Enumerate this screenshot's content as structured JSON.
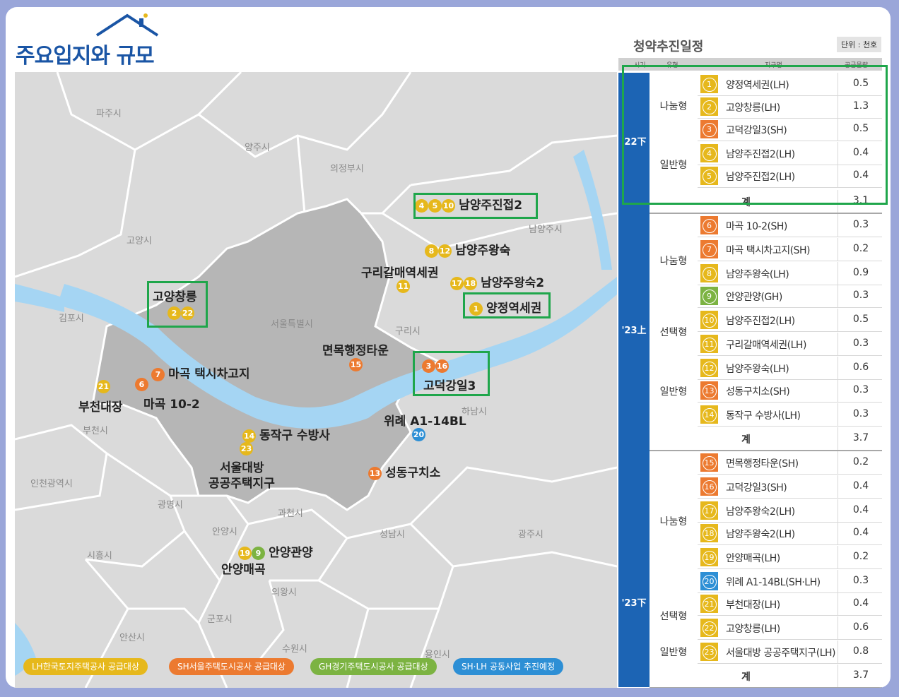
{
  "title": "주요입지와 규모",
  "map": {
    "places": [
      "파주시",
      "양주시",
      "의정부시",
      "남양주시",
      "고양시",
      "김포시",
      "서울특별시",
      "구리시",
      "하남시",
      "부천시",
      "인천광역시",
      "광명시",
      "과천시",
      "안양시",
      "성남시",
      "광주시",
      "시흥시",
      "의왕시",
      "군포시",
      "안산시",
      "수원시",
      "용인시"
    ],
    "sites": [
      {
        "name": "남양주진접2",
        "markers": [
          "4",
          "5",
          "10"
        ]
      },
      {
        "name": "남양주왕숙",
        "markers": [
          "8",
          "12"
        ]
      },
      {
        "name": "구리갈매역세권",
        "markers": [
          "11"
        ]
      },
      {
        "name": "남양주왕숙2",
        "markers": [
          "17",
          "18"
        ]
      },
      {
        "name": "양정역세권",
        "markers": [
          "1"
        ]
      },
      {
        "name": "고양창릉",
        "markers": [
          "2",
          "22"
        ]
      },
      {
        "name": "면목행정타운",
        "markers": [
          "15"
        ]
      },
      {
        "name": "고덕강일3",
        "markers": [
          "3",
          "16"
        ]
      },
      {
        "name": "마곡 택시차고지",
        "markers": [
          "7"
        ]
      },
      {
        "name": "마곡 10-2",
        "markers": [
          "6"
        ]
      },
      {
        "name": "부천대장",
        "markers": [
          "21"
        ]
      },
      {
        "name": "동작구 수방사",
        "markers": [
          "14",
          "23"
        ]
      },
      {
        "name": "서울대방",
        "sub": "공공주택지구"
      },
      {
        "name": "위례 A1-14BL",
        "markers": [
          "20"
        ]
      },
      {
        "name": "성동구치소",
        "markers": [
          "13"
        ]
      },
      {
        "name": "안양관양",
        "markers": [
          "19",
          "9"
        ]
      },
      {
        "name": "안양매곡"
      }
    ],
    "legend": [
      "LH한국토지주택공사 공급대상",
      "SH서울주택도시공사 공급대상",
      "GH경기주택도시공사 공급대상",
      "SH·LH 공동사업 추진예정"
    ]
  },
  "table": {
    "title": "청약추진일정",
    "unit": "단위 : 천호",
    "headers": [
      "시기",
      "유형",
      "지구명",
      "공급물량"
    ],
    "rows": [
      {
        "num": "1",
        "name": "양정역세권(LH)",
        "val": "0.5",
        "color": "#e6b81c"
      },
      {
        "num": "2",
        "name": "고양창릉(LH)",
        "val": "1.3",
        "color": "#e6b81c"
      },
      {
        "num": "3",
        "name": "고덕강일3(SH)",
        "val": "0.5",
        "color": "#ec7a30"
      },
      {
        "num": "4",
        "name": "남양주진접2(LH)",
        "val": "0.4",
        "color": "#e6b81c"
      },
      {
        "num": "5",
        "name": "남양주진접2(LH)",
        "val": "0.4",
        "color": "#e6b81c"
      },
      {
        "num": "6",
        "name": "마곡 10-2(SH)",
        "val": "0.3",
        "color": "#ec7a30"
      },
      {
        "num": "7",
        "name": "마곡 택시차고지(SH)",
        "val": "0.2",
        "color": "#ec7a30"
      },
      {
        "num": "8",
        "name": "남양주왕숙(LH)",
        "val": "0.9",
        "color": "#e6b81c"
      },
      {
        "num": "9",
        "name": "안양관양(GH)",
        "val": "0.3",
        "color": "#7cb342"
      },
      {
        "num": "10",
        "name": "남양주진접2(LH)",
        "val": "0.5",
        "color": "#e6b81c"
      },
      {
        "num": "11",
        "name": "구리갈매역세권(LH)",
        "val": "0.3",
        "color": "#e6b81c"
      },
      {
        "num": "12",
        "name": "남양주왕숙(LH)",
        "val": "0.6",
        "color": "#e6b81c"
      },
      {
        "num": "13",
        "name": "성동구치소(SH)",
        "val": "0.3",
        "color": "#ec7a30"
      },
      {
        "num": "14",
        "name": "동작구 수방사(LH)",
        "val": "0.3",
        "color": "#e6b81c"
      },
      {
        "num": "15",
        "name": "면목행정타운(SH)",
        "val": "0.2",
        "color": "#ec7a30"
      },
      {
        "num": "16",
        "name": "고덕강일3(SH)",
        "val": "0.4",
        "color": "#ec7a30"
      },
      {
        "num": "17",
        "name": "남양주왕숙2(LH)",
        "val": "0.4",
        "color": "#e6b81c"
      },
      {
        "num": "18",
        "name": "남양주왕숙2(LH)",
        "val": "0.4",
        "color": "#e6b81c"
      },
      {
        "num": "19",
        "name": "안양매곡(LH)",
        "val": "0.2",
        "color": "#e6b81c"
      },
      {
        "num": "20",
        "name": "위례 A1-14BL(SH·LH)",
        "val": "0.3",
        "color": "#2d8fd5"
      },
      {
        "num": "21",
        "name": "부천대장(LH)",
        "val": "0.4",
        "color": "#e6b81c"
      },
      {
        "num": "22",
        "name": "고양창릉(LH)",
        "val": "0.6",
        "color": "#e6b81c"
      },
      {
        "num": "23",
        "name": "서울대방 공공주택지구(LH)",
        "val": "0.8",
        "color": "#e6b81c"
      }
    ],
    "periods": [
      "'22下",
      "'23上",
      "'23下"
    ],
    "types": [
      "나눔형",
      "일반형",
      "나눔형",
      "선택형",
      "일반형",
      "나눔형",
      "선택형",
      "일반형"
    ],
    "sum_label": "계",
    "sums": [
      "3.1",
      "3.7",
      "3.7"
    ]
  }
}
